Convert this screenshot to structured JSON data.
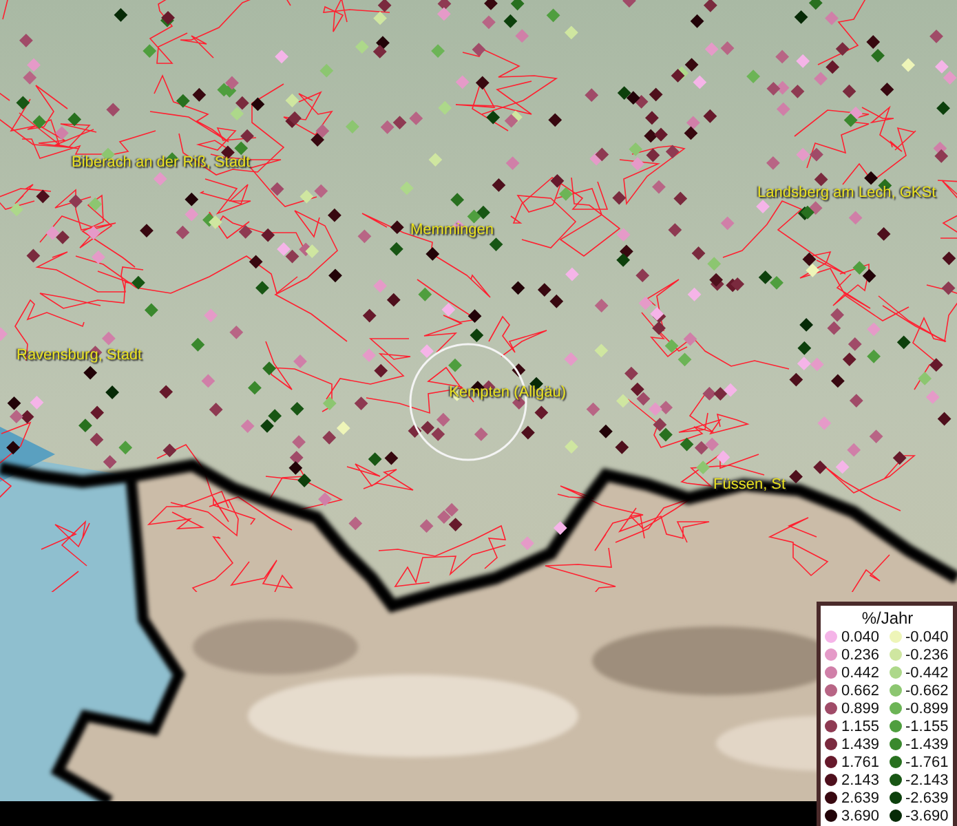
{
  "map": {
    "place_labels": [
      {
        "text": "Biberach an der Riß, Stadt"
      },
      {
        "text": "Memmingen"
      },
      {
        "text": "Landsberg am Lech, GKSt"
      },
      {
        "text": "Ravensburg, Stadt"
      },
      {
        "text": "Kempten (Allgäu)"
      },
      {
        "text": "Füssen, St"
      }
    ]
  },
  "legend": {
    "title": "%/Jahr",
    "items": [
      {
        "label": "0.040",
        "color": "#f5b4e8"
      },
      {
        "label": "0.236",
        "color": "#e59ac8"
      },
      {
        "label": "0.442",
        "color": "#d07fa8"
      },
      {
        "label": "0.662",
        "color": "#b86585"
      },
      {
        "label": "0.899",
        "color": "#a04b68"
      },
      {
        "label": "1.155",
        "color": "#8e3a52"
      },
      {
        "label": "1.439",
        "color": "#7a2a3e"
      },
      {
        "label": "1.761",
        "color": "#66192b"
      },
      {
        "label": "2.143",
        "color": "#4e0f1c"
      },
      {
        "label": "2.639",
        "color": "#380810"
      },
      {
        "label": "3.690",
        "color": "#220308"
      },
      {
        "label": "-0.040",
        "color": "#eef5b8"
      },
      {
        "label": "-0.236",
        "color": "#cfe6a0"
      },
      {
        "label": "-0.442",
        "color": "#add88a"
      },
      {
        "label": "-0.662",
        "color": "#8cc670"
      },
      {
        "label": "-0.899",
        "color": "#6cb456"
      },
      {
        "label": "-1.155",
        "color": "#4f9e3e"
      },
      {
        "label": "-1.439",
        "color": "#3a882d"
      },
      {
        "label": "-1.761",
        "color": "#28701f"
      },
      {
        "label": "-2.143",
        "color": "#185614"
      },
      {
        "label": "-2.639",
        "color": "#0d400c"
      },
      {
        "label": "-3.690",
        "color": "#062a06"
      }
    ]
  }
}
